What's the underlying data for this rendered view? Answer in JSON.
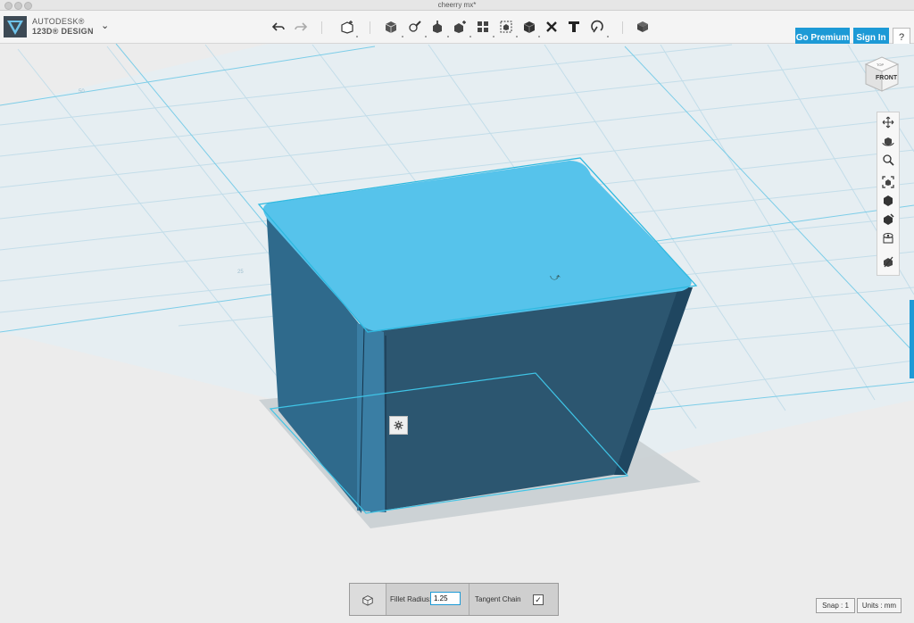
{
  "window": {
    "title": "cheerry mx*"
  },
  "brand": {
    "line1": "AUTODESK®",
    "line2": "123D® DESIGN",
    "accent": "#1d9ad6"
  },
  "toolbar": {
    "undo_icon": "undo-icon",
    "redo_icon": "redo-icon",
    "tools": [
      "primitives-icon",
      "sketch-icon",
      "construct-icon",
      "modify-icon",
      "pattern-icon",
      "grouping-icon",
      "combine-icon",
      "measure-icon",
      "text-icon",
      "snap-icon",
      "material-icon"
    ]
  },
  "account": {
    "premium_label": "Go Premium",
    "signin_label": "Sign In",
    "help_label": "?"
  },
  "viewcube": {
    "top_label": "TOP",
    "front_label": "FRONT"
  },
  "navbar": {
    "tools": [
      "pan-icon",
      "orbit-icon",
      "zoom-icon",
      "fit-icon",
      "view-mode-icon",
      "material-view-icon",
      "visibility-icon",
      "selection-icon"
    ]
  },
  "grid": {
    "label_a": "50",
    "label_b": "25"
  },
  "fillet_panel": {
    "radius_label": "Fillet Radius:",
    "radius_value": "1.25",
    "tangent_label": "Tangent Chain",
    "tangent_checked": "✓"
  },
  "status": {
    "snap": "Snap : 1",
    "units": "Units : mm"
  }
}
